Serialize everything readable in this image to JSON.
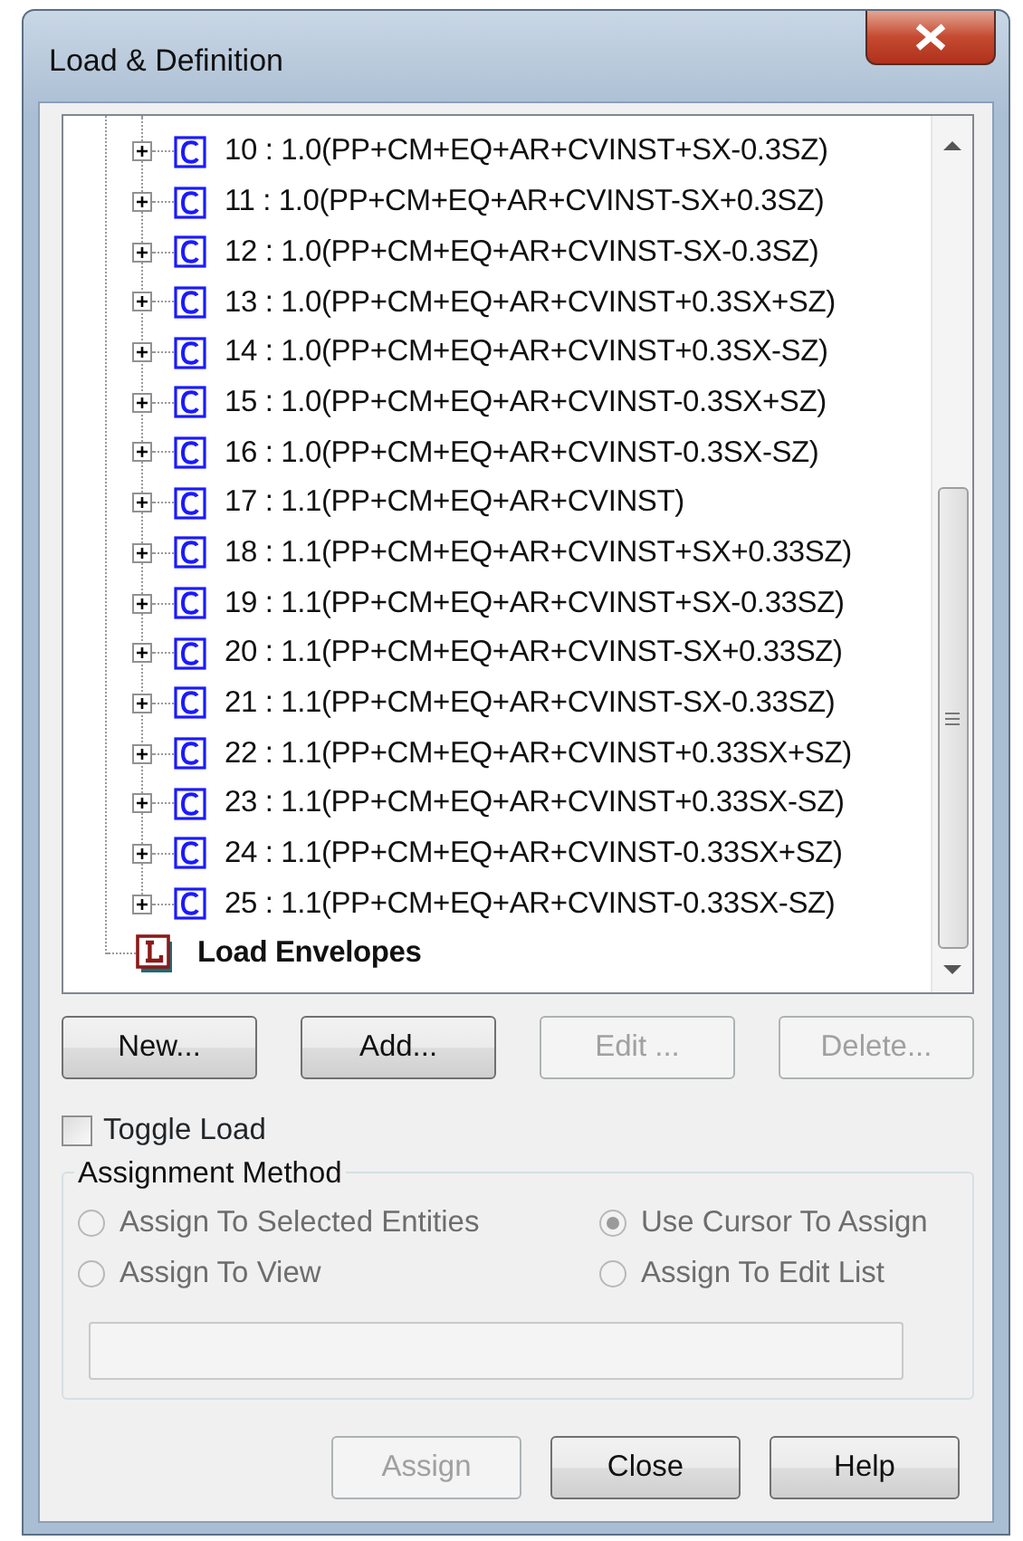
{
  "window": {
    "title": "Load & Definition"
  },
  "tree": {
    "items": [
      {
        "kind": "combination",
        "label": "10 : 1.0(PP+CM+EQ+AR+CVINST+SX-0.3SZ)",
        "expanded": false,
        "selected": false
      },
      {
        "kind": "combination",
        "label": "11 : 1.0(PP+CM+EQ+AR+CVINST-SX+0.3SZ)",
        "expanded": false,
        "selected": false
      },
      {
        "kind": "combination",
        "label": "12 : 1.0(PP+CM+EQ+AR+CVINST-SX-0.3SZ)",
        "expanded": false,
        "selected": false
      },
      {
        "kind": "combination",
        "label": "13 : 1.0(PP+CM+EQ+AR+CVINST+0.3SX+SZ)",
        "expanded": false,
        "selected": false
      },
      {
        "kind": "combination",
        "label": "14 : 1.0(PP+CM+EQ+AR+CVINST+0.3SX-SZ)",
        "expanded": false,
        "selected": false
      },
      {
        "kind": "combination",
        "label": "15 : 1.0(PP+CM+EQ+AR+CVINST-0.3SX+SZ)",
        "expanded": false,
        "selected": false
      },
      {
        "kind": "combination",
        "label": "16 : 1.0(PP+CM+EQ+AR+CVINST-0.3SX-SZ)",
        "expanded": false,
        "selected": false
      },
      {
        "kind": "combination",
        "label": "17 : 1.1(PP+CM+EQ+AR+CVINST)",
        "expanded": false,
        "selected": false
      },
      {
        "kind": "combination",
        "label": "18 : 1.1(PP+CM+EQ+AR+CVINST+SX+0.33SZ)",
        "expanded": false,
        "selected": false
      },
      {
        "kind": "combination",
        "label": "19 : 1.1(PP+CM+EQ+AR+CVINST+SX-0.33SZ)",
        "expanded": false,
        "selected": false
      },
      {
        "kind": "combination",
        "label": "20 : 1.1(PP+CM+EQ+AR+CVINST-SX+0.33SZ)",
        "expanded": false,
        "selected": false
      },
      {
        "kind": "combination",
        "label": "21 : 1.1(PP+CM+EQ+AR+CVINST-SX-0.33SZ)",
        "expanded": false,
        "selected": false
      },
      {
        "kind": "combination",
        "label": "22 : 1.1(PP+CM+EQ+AR+CVINST+0.33SX+SZ)",
        "expanded": false,
        "selected": false
      },
      {
        "kind": "combination",
        "label": "23 : 1.1(PP+CM+EQ+AR+CVINST+0.33SX-SZ)",
        "expanded": false,
        "selected": false
      },
      {
        "kind": "combination",
        "label": "24 : 1.1(PP+CM+EQ+AR+CVINST-0.33SX+SZ)",
        "expanded": false,
        "selected": false
      },
      {
        "kind": "combination",
        "label": "25 : 1.1(PP+CM+EQ+AR+CVINST-0.33SX-SZ)",
        "expanded": false,
        "selected": false
      },
      {
        "kind": "envelope",
        "label": "Load Envelopes",
        "selected": false
      }
    ]
  },
  "tree_buttons": [
    {
      "label": "New...",
      "disabled": false
    },
    {
      "label": "Add...",
      "disabled": false
    },
    {
      "label": "Edit ...",
      "disabled": true
    },
    {
      "label": "Delete...",
      "disabled": true
    }
  ],
  "toggle_load": {
    "label": "Toggle Load",
    "checked": false
  },
  "assignment_method": {
    "title": "Assignment Method",
    "options": [
      {
        "label": "Assign To Selected Entities",
        "selected": false,
        "disabled": true
      },
      {
        "label": "Use Cursor To Assign",
        "selected": true,
        "disabled": true
      },
      {
        "label": "Assign To View",
        "selected": false,
        "disabled": true
      },
      {
        "label": "Assign To Edit List",
        "selected": false,
        "disabled": true
      }
    ],
    "field": {
      "disabled": true
    }
  },
  "buttons": [
    {
      "label": "Assign",
      "disabled": true
    },
    {
      "label": "Close",
      "disabled": false
    },
    {
      "label": "Help",
      "disabled": false
    }
  ]
}
